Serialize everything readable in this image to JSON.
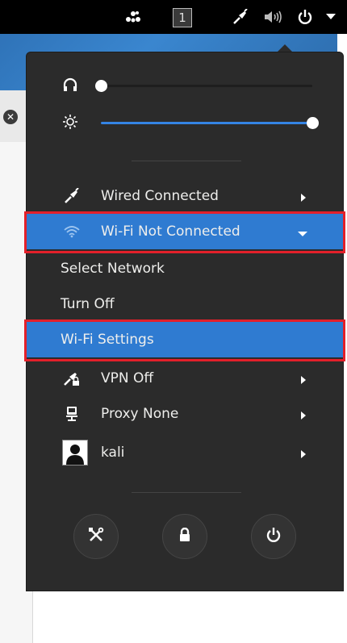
{
  "topbar": {
    "workspace_number": "1",
    "icons": [
      "apps-icon",
      "wired-network-icon",
      "volume-icon",
      "power-icon",
      "dropdown-arrow-icon"
    ]
  },
  "sliders": [
    {
      "name": "volume",
      "icon": "headphones-icon",
      "level": 0.0
    },
    {
      "name": "brightness",
      "icon": "brightness-icon",
      "level": 1.0
    }
  ],
  "menu": {
    "wired": {
      "label": "Wired Connected",
      "icon": "wired-network-icon"
    },
    "wifi": {
      "label": "Wi-Fi Not Connected",
      "icon": "wifi-icon"
    },
    "wifi_submenu": {
      "select_network": "Select Network",
      "turn_off": "Turn Off",
      "settings": "Wi-Fi Settings"
    },
    "vpn": {
      "label": "VPN Off",
      "icon": "vpn-icon"
    },
    "proxy": {
      "label": "Proxy None",
      "icon": "proxy-icon"
    },
    "user": {
      "label": "kali",
      "icon": "avatar-icon"
    }
  },
  "bottom_buttons": [
    {
      "name": "settings-button",
      "icon": "tools-icon"
    },
    {
      "name": "lock-button",
      "icon": "lock-icon"
    },
    {
      "name": "power-button",
      "icon": "power-icon"
    }
  ],
  "colors": {
    "menu_bg": "#2b2b2b",
    "highlight": "#2f7bd1",
    "annotation_outline": "#e3202a",
    "slider_fill": "#3584e4"
  }
}
